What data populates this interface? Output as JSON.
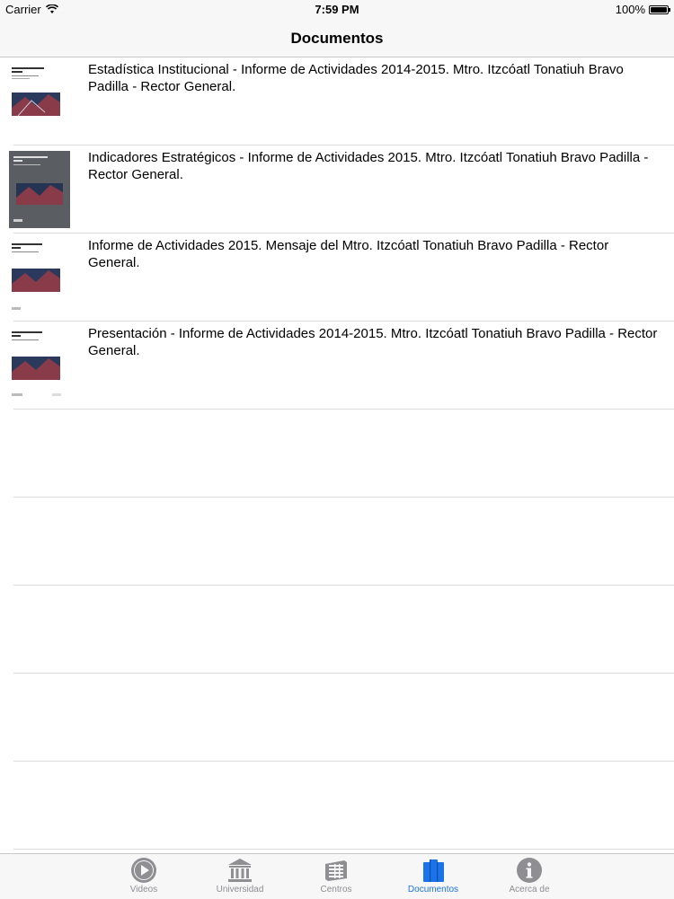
{
  "status_bar": {
    "carrier": "Carrier",
    "time": "7:59 PM",
    "battery": "100%"
  },
  "nav": {
    "title": "Documentos"
  },
  "documents": [
    {
      "title": "Estadística Institucional - Informe de Actividades 2014-2015. Mtro. Itzcóatl Tonatiuh Bravo Padilla - Rector General.",
      "thumb_style": "light"
    },
    {
      "title": "Indicadores Estratégicos - Informe de Actividades 2015. Mtro. Itzcóatl Tonatiuh Bravo Padilla - Rector General.",
      "thumb_style": "dark"
    },
    {
      "title": "Informe de Actividades 2015. Mensaje del Mtro. Itzcóatl Tonatiuh Bravo Padilla - Rector General.",
      "thumb_style": "light"
    },
    {
      "title": "Presentación - Informe de Actividades 2014-2015. Mtro. Itzcóatl Tonatiuh Bravo Padilla - Rector General.",
      "thumb_style": "light"
    }
  ],
  "tabs": [
    {
      "label": "Videos",
      "icon": "play-icon",
      "active": false
    },
    {
      "label": "Universidad",
      "icon": "building-icon",
      "active": false
    },
    {
      "label": "Centros",
      "icon": "centros-icon",
      "active": false
    },
    {
      "label": "Documentos",
      "icon": "books-icon",
      "active": true
    },
    {
      "label": "Acerca de",
      "icon": "info-icon",
      "active": false
    }
  ],
  "colors": {
    "accent": "#1a73e8",
    "inactive": "#8e8e93",
    "separator": "#dcdcdc"
  }
}
